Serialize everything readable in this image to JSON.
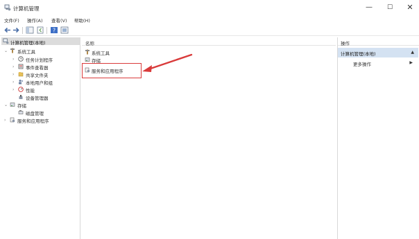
{
  "window": {
    "title": "计算机管理",
    "minimize": "—",
    "maximize": "☐",
    "close": "✕"
  },
  "menu": [
    "文件(F)",
    "操作(A)",
    "查看(V)",
    "帮助(H)"
  ],
  "tree": {
    "root": "计算机管理(本地)",
    "items": [
      {
        "label": "系统工具",
        "expander": "⌄",
        "icon": "tools-icon"
      },
      {
        "label": "任务计划程序",
        "expander": "›",
        "icon": "clock-icon"
      },
      {
        "label": "事件查看器",
        "expander": "›",
        "icon": "event-viewer-icon"
      },
      {
        "label": "共享文件夹",
        "expander": "›",
        "icon": "shared-folder-icon"
      },
      {
        "label": "本地用户和组",
        "expander": "›",
        "icon": "users-icon"
      },
      {
        "label": "性能",
        "expander": "›",
        "icon": "performance-icon"
      },
      {
        "label": "设备管理器",
        "expander": "",
        "icon": "device-manager-icon"
      },
      {
        "label": "存储",
        "expander": "⌄",
        "icon": "storage-icon"
      },
      {
        "label": "磁盘管理",
        "expander": "",
        "icon": "disk-icon"
      },
      {
        "label": "服务和应用程序",
        "expander": "›",
        "icon": "services-icon"
      }
    ]
  },
  "center": {
    "column_header": "名称",
    "items": [
      {
        "label": "系统工具",
        "icon": "tools-icon"
      },
      {
        "label": "存储",
        "icon": "storage-icon"
      },
      {
        "label": "服务和应用程序",
        "icon": "services-icon"
      }
    ]
  },
  "actions": {
    "header": "操作",
    "section": "计算机管理(本地)",
    "more": "更多操作",
    "caret_up": "▲",
    "caret_right": "▶"
  },
  "colors": {
    "selection": "#d4e2f2",
    "annotation": "#d93a3a"
  }
}
